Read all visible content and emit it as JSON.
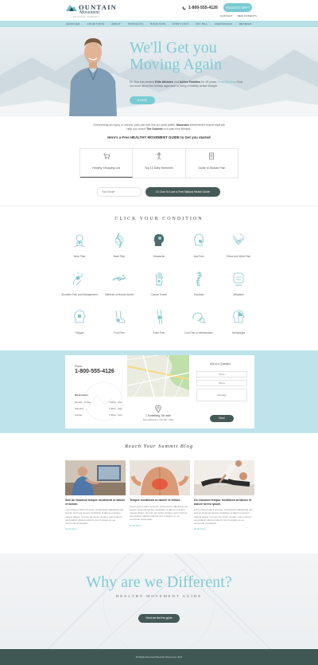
{
  "header": {
    "logo_main": "OUNTAIN",
    "logo_script": "Movement",
    "logo_tagline": "PHYSICAL THERAPY",
    "phone": "1-800-555-4126",
    "cta_label": "REQUEST APPT",
    "sub_links": [
      "CONTACT",
      "NEW PATIENTS"
    ]
  },
  "nav": {
    "items": [
      "SERVICES",
      "CONDITIONS",
      "ABOUT",
      "PRODUCTS",
      "BOOK NOW",
      "FIRST VISIT",
      "PAY BILL",
      "RESOURCES",
      "REVIEWS"
    ]
  },
  "hero": {
    "title_line1": "We'll Get you",
    "title_line2": "Moving Again",
    "text_pre": "Dr. Doe has treated",
    "text_b1": "Elite Athletes",
    "text_mid1": "and",
    "text_b2": "Active Families",
    "text_mid2": "for 15 years.",
    "text_link": "Read Reviews",
    "text_post": "Find out more about the holistic approach to living a healthy active lifestyle.",
    "button": "STORY"
  },
  "intro": {
    "text_pre": "Overcoming an injury or chronic pain can feel like an uphill battle,",
    "text_b1": "Mountain",
    "text_mid": "Movement's expert staff will help you reach",
    "text_b2": "The Summit",
    "text_post": "of a pain free lifestyle.",
    "cta": "Here's a Free HEALTHY MOVEMENT GUIDE to Get you started"
  },
  "tabs": [
    {
      "label": "Healthy Shopping List",
      "icon": "cart-icon",
      "active": true
    },
    {
      "label": "Top 10 Daily Stretches",
      "icon": "stretch-icon",
      "active": false
    },
    {
      "label": "Guide to Muscle Pain",
      "icon": "document-icon",
      "active": false
    }
  ],
  "optin": {
    "email_placeholder": "Your Email*",
    "button": "Dr. Doe I'd Love a Free Natural Health Guide"
  },
  "conditions": {
    "title": "CLICK YOUR CONDITION",
    "items": [
      {
        "label": "Neck Pain",
        "icon": "neck-icon"
      },
      {
        "label": "Back Pain",
        "icon": "spine-icon"
      },
      {
        "label": "Headache",
        "icon": "head-icon"
      },
      {
        "label": "Jaw Pain",
        "icon": "jaw-icon"
      },
      {
        "label": "Elbow and Wrist Pain",
        "icon": "elbow-icon"
      },
      {
        "label": "Shoulder Pain and Management",
        "icon": "shoulder-icon"
      },
      {
        "label": "Stiffness or Muscle Aches",
        "icon": "muscle-icon"
      },
      {
        "label": "Carpal Tunnel",
        "icon": "hand-icon"
      },
      {
        "label": "Scoliosis",
        "icon": "scoliosis-icon"
      },
      {
        "label": "Whiplash",
        "icon": "whiplash-icon"
      },
      {
        "label": "Fatigue",
        "icon": "fatigue-icon"
      },
      {
        "label": "Foot Pain",
        "icon": "foot-icon"
      },
      {
        "label": "Knee Pain",
        "icon": "knee-icon"
      },
      {
        "label": "Cold Pain & Inflammation",
        "icon": "inflammation-icon"
      },
      {
        "label": "Hemiplegia",
        "icon": "hemiplegia-icon"
      }
    ]
  },
  "contact": {
    "phone_label": "Phone",
    "phone": "1-800-555-4126",
    "hours_title": "Work Hours",
    "hours": [
      {
        "day": "Monday - Friday",
        "time": "7:00am - 5pm"
      },
      {
        "day": "Saturday",
        "time": "7:00am - 2pm"
      },
      {
        "day": "Sunday",
        "time": "7:00am - 2pm"
      }
    ],
    "address_line1": "1 Something, Str. addr",
    "address_line2": "Mountaintown, City RL, USA",
    "form_title": "Ask us a Question",
    "form_fields": [
      "Name",
      "Phone",
      "Message"
    ],
    "form_button": "Send"
  },
  "blog": {
    "title": "Reach Your Summit Blog",
    "posts": [
      {
        "title": "Sed do eiusmod tempor incididunt ut labore et dolore.",
        "excerpt": "Lorem ipsum dolor sit amet, consectetur adipisicing elit sed do eiusmod tempor incididunt ut labore et dolore magna aliqua. Ut enim ad minim veniam, quis nostrud exercitation ullamco laboris nisi ut aliquip ex ea commodo consequat.",
        "more": "Read More"
      },
      {
        "title": "Tempor incididunt ut labore et dolore.",
        "excerpt": "Lorem ipsum dolor sit amet, consectetur adipisicing elit sed do eiusmod tempor incididunt ut labore et dolore magna aliqua. Ut enim ad minim veniam, quis nostrud exercitation ullamco laboris nisi ut aliquip ex ea commodo consequat.",
        "more": "Read More"
      },
      {
        "title": "Do eiusmod tempor incididunt ut labore et dolore lorem ipsum.",
        "excerpt": "Lorem ipsum dolor sit amet, consectetur adipisicing elit sed do eiusmod tempor incididunt ut labore et dolore magna aliqua. Ut enim ad minim veniam, quis nostrud exercitation ullamco laboris nisi ut aliquip ex ea commodo consequat.",
        "more": "Read More"
      }
    ]
  },
  "why": {
    "title": "Why are we Different?",
    "subtitle": "HEALTHY MOVEMENT GUIDE",
    "button": "Send me the free guide"
  },
  "footer": {
    "text": "All Rights Reserved Mountain Movement, 2016"
  },
  "colors": {
    "accent": "#78cbd3",
    "dark": "#455a58",
    "nav_bg": "#b8dee6",
    "band_bg": "#bfe3eb",
    "footer_bg": "#3f5853"
  }
}
